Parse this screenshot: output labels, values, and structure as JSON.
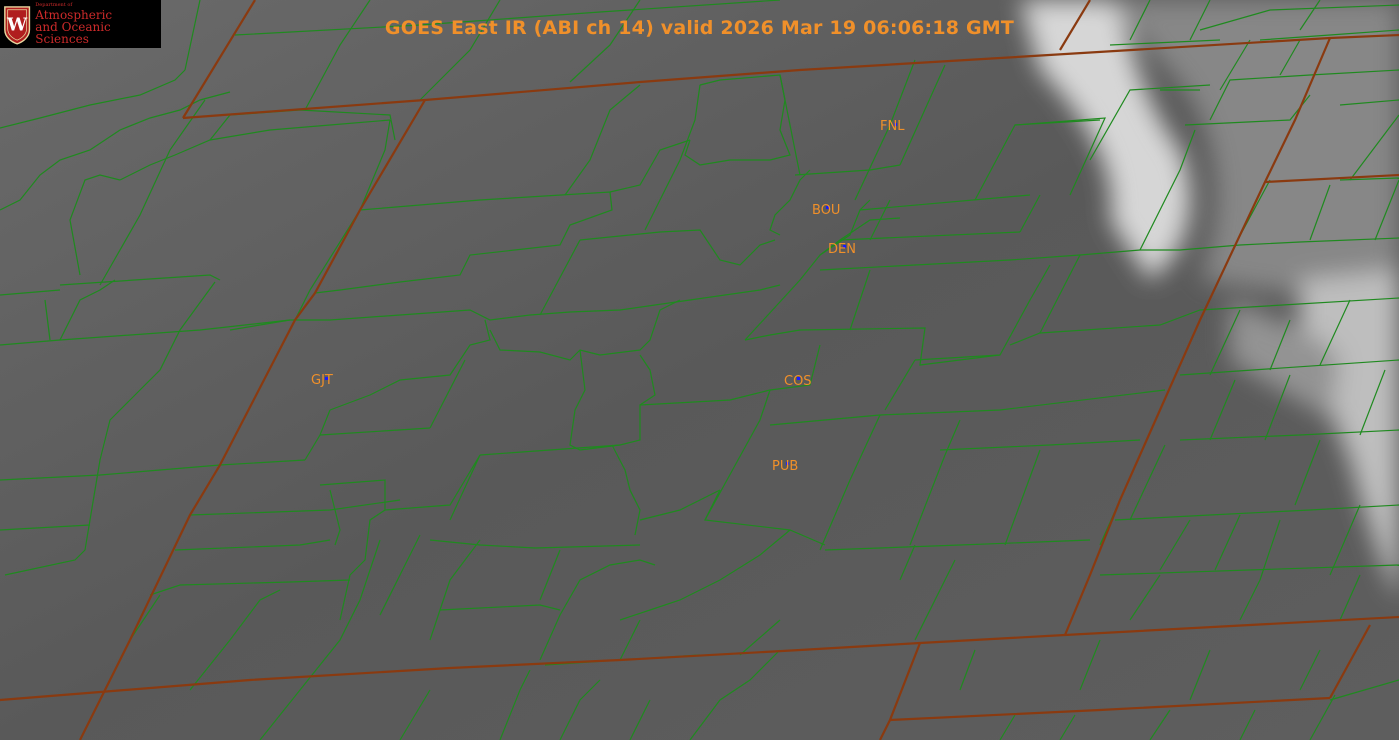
{
  "title": "GOES East IR (ABI ch 14) valid 2026 Mar 19 06:06:18 GMT",
  "logo": {
    "department": "Department of",
    "line1": "Atmospheric",
    "line2": "and Oceanic Sciences",
    "seal_letter": "W"
  },
  "stations": [
    {
      "id": "FNL"
    },
    {
      "id": "BOU"
    },
    {
      "id": "DEN"
    },
    {
      "id": "GJT"
    },
    {
      "id": "COS"
    },
    {
      "id": "PUB"
    }
  ],
  "colors": {
    "county_lines": "#1f8a1f",
    "state_lines": "#8a3a10",
    "label": "#f0902a",
    "station_marker": "#1a1aff"
  }
}
